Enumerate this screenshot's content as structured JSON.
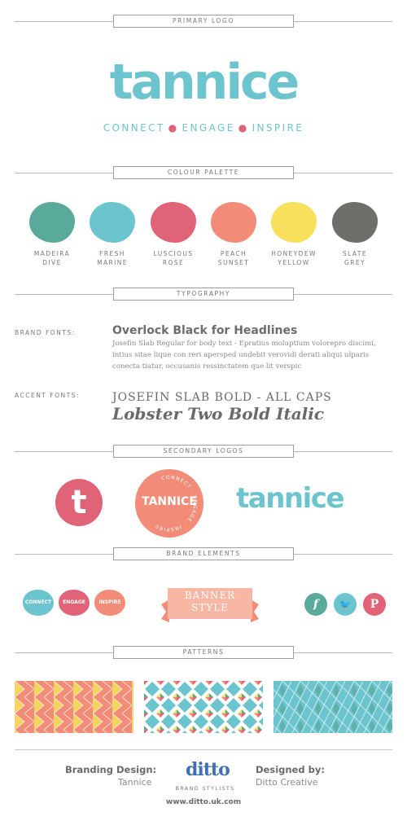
{
  "sections": {
    "primary_logo": "PRIMARY LOGO",
    "colour_palette": "COLOUR PALETTE",
    "typography": "TYPOGRAPHY",
    "secondary_logos": "SECONDARY LOGOS",
    "brand_elements": "BRAND ELEMENTS",
    "patterns": "PATTERNS"
  },
  "logo": {
    "wordmark": "tannice",
    "tagline": [
      "CONNECT",
      "ENGAGE",
      "INSPIRE"
    ],
    "tagline_color": "#6cc4cf",
    "dot_color": "#e06377"
  },
  "palette": [
    {
      "line1": "MADEIRA",
      "line2": "DIVE",
      "color": "#5aaa9c"
    },
    {
      "line1": "FRESH",
      "line2": "MARINE",
      "color": "#6cc4cf"
    },
    {
      "line1": "LUSCIOUS",
      "line2": "ROSE",
      "color": "#e06377"
    },
    {
      "line1": "PEACH",
      "line2": "SUNSET",
      "color": "#f28c78"
    },
    {
      "line1": "HONEYDEW",
      "line2": "YELLOW",
      "color": "#f8e05c"
    },
    {
      "line1": "SLATE",
      "line2": "GREY",
      "color": "#6e6e6a"
    }
  ],
  "typography": {
    "brand_label": "BRAND FONTS:",
    "headline": "Overlock Black for Headlines",
    "body": "Josefin Slab Regular for body text - Epratius moluptium volorepro discimi, intius sitae lique con reri apersped undebit verovidi derati aliqui ulparis conecta tiatur, occusanis ressinctatem que lit verspic",
    "accent_label": "ACCENT FONTS:",
    "accent1": "JOSEFIN SLAB BOLD - ALL CAPS",
    "accent2": "Lobster Two Bold Italic"
  },
  "secondary": {
    "t_letter": "t",
    "badge_name": "TANNICE",
    "badge_ring": "CONNECT · ENGAGE · INSPIRE",
    "wordmark": "tannice"
  },
  "elements": {
    "blobs": [
      {
        "label": "CONNECT",
        "color": "#6cc4cf"
      },
      {
        "label": "ENGAGE",
        "color": "#e06377"
      },
      {
        "label": "INSPIRE",
        "color": "#f28c78"
      }
    ],
    "banner_line1": "BANNER",
    "banner_line2": "STYLE",
    "social": [
      {
        "glyph": "f",
        "icon": "facebook-icon",
        "color": "#5aaa9c"
      },
      {
        "glyph": "🐦",
        "icon": "twitter-icon",
        "color": "#6cc4cf"
      },
      {
        "glyph": "P",
        "icon": "pinterest-icon",
        "color": "#e06377"
      }
    ]
  },
  "footer": {
    "left_title": "Branding Design:",
    "left_sub": "Tannice",
    "center_logo": "ditto",
    "center_sub": "BRAND STYLISTS",
    "right_title": "Designed by:",
    "right_sub": "Ditto Creative",
    "url": "www.ditto.uk.com"
  }
}
